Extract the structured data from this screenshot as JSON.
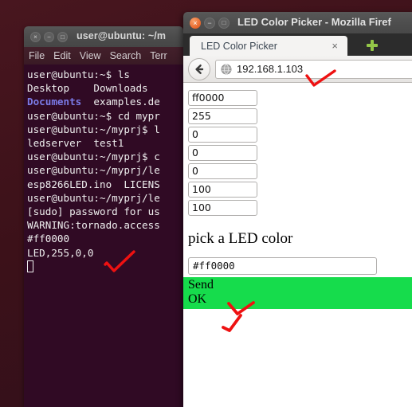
{
  "desktop": {
    "background_color": "#3C1119"
  },
  "terminal": {
    "window_title": "user@ubuntu: ~/m",
    "titlebar_buttons": [
      {
        "name": "close",
        "glyph": "×"
      },
      {
        "name": "minimize",
        "glyph": "−"
      },
      {
        "name": "maximize",
        "glyph": "□"
      }
    ],
    "menu": [
      "File",
      "Edit",
      "View",
      "Search",
      "Terr"
    ],
    "background_color": "#300A24",
    "text_color": "#EFEFEF",
    "dir_color": "#7B7BE8",
    "lines": [
      {
        "text": "user@ubuntu:~$ ls",
        "type": "plain"
      },
      {
        "text": "Desktop    Downloads",
        "type": "dir"
      },
      {
        "text": "Documents  examples.de",
        "type": "dir-partial"
      },
      {
        "text": "user@ubuntu:~$ cd mypr",
        "type": "plain"
      },
      {
        "text": "user@ubuntu:~/myprj$ l",
        "type": "plain"
      },
      {
        "text": "ledserver  test1",
        "type": "dir"
      },
      {
        "text": "user@ubuntu:~/myprj$ c",
        "type": "plain"
      },
      {
        "text": "user@ubuntu:~/myprj/le",
        "type": "plain"
      },
      {
        "text": "esp8266LED.ino  LICENS",
        "type": "plain"
      },
      {
        "text": "user@ubuntu:~/myprj/le",
        "type": "plain"
      },
      {
        "text": "[sudo] password for us",
        "type": "plain"
      },
      {
        "text": "WARNING:tornado.access",
        "type": "plain"
      },
      {
        "text": "#ff0000",
        "type": "plain"
      },
      {
        "text": "LED,255,0,0",
        "type": "plain"
      }
    ],
    "line2_dir_part": "Documents",
    "line2_rest": "  examples.de",
    "cursor": "block"
  },
  "firefox": {
    "window_title": "LED Color Picker - Mozilla Firef",
    "titlebar_buttons": [
      {
        "name": "close",
        "glyph": "×"
      },
      {
        "name": "minimize",
        "glyph": "−"
      },
      {
        "name": "maximize",
        "glyph": "□"
      }
    ],
    "tab": {
      "label": "LED Color Picker",
      "close_glyph": "×"
    },
    "new_tab_label": "+",
    "back_glyph": "←",
    "url": "192.168.1.103",
    "content": {
      "rgb_fields": [
        {
          "name": "hex-field",
          "value": "ff0000"
        },
        {
          "name": "red-field",
          "value": "255"
        },
        {
          "name": "green-field",
          "value": "0"
        },
        {
          "name": "blue-field",
          "value": "0"
        },
        {
          "name": "extra-field",
          "value": "0"
        },
        {
          "name": "width-field",
          "value": "100"
        },
        {
          "name": "height-field",
          "value": "100"
        }
      ],
      "heading": "pick a LED color",
      "color_input_value": "#ff0000",
      "send_label": "Send",
      "status_label": "OK",
      "status_background": "#16DC4C"
    }
  },
  "annotations": {
    "color": "#EE1111",
    "marks": [
      {
        "name": "checkmark-terminal-led",
        "shape": "check"
      },
      {
        "name": "checkmark-url",
        "shape": "check"
      },
      {
        "name": "checkmark-send",
        "shape": "swoosh"
      },
      {
        "name": "checkmark-ok",
        "shape": "swoosh"
      }
    ]
  }
}
